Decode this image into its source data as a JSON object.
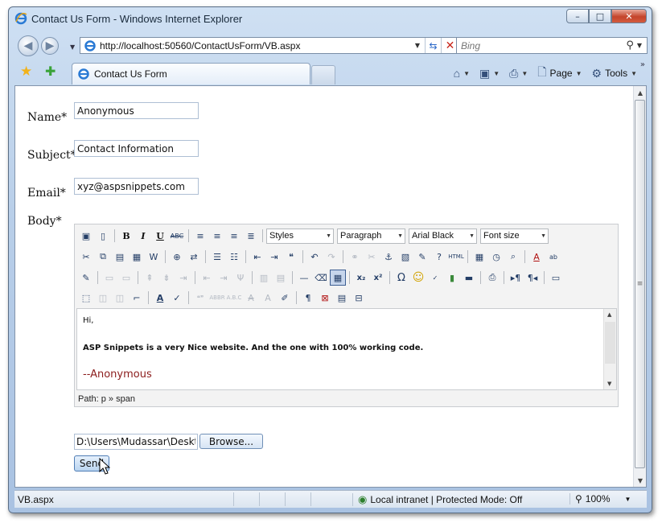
{
  "window": {
    "title": "Contact Us Form - Windows Internet Explorer",
    "controls": {
      "minimize": "–",
      "maximize": "□",
      "close": "✕"
    }
  },
  "address_bar": {
    "url": "http://localhost:50560/ContactUsForm/VB.aspx",
    "search_placeholder": "Bing"
  },
  "tab": {
    "label": "Contact Us Form"
  },
  "command_bar": {
    "page_label": "Page",
    "tools_label": "Tools"
  },
  "form": {
    "name_label": "Name*",
    "name_value": "Anonymous",
    "subject_label": "Subject*",
    "subject_value": "Contact Information",
    "email_label": "Email*",
    "email_value": "xyz@aspsnippets.com",
    "body_label": "Body*",
    "file_value": "D:\\Users\\Mudassar\\Deskt",
    "browse_label": "Browse...",
    "send_label": "Send"
  },
  "editor": {
    "styles": "Styles",
    "format": "Paragraph",
    "font": "Arial Black",
    "size": "Font size",
    "line1": "Hi,",
    "line2": "ASP Snippets is a very Nice website. And the one with 100% working code.",
    "line3": "--Anonymous",
    "path": "Path: p » span"
  },
  "status": {
    "text": "VB.aspx",
    "zone": "Local intranet | Protected Mode: Off",
    "zoom": "100%"
  },
  "colors": {
    "chrome": "#b9cfe9",
    "close_button": "#c4442b",
    "signature_text": "#8b1c1c"
  }
}
